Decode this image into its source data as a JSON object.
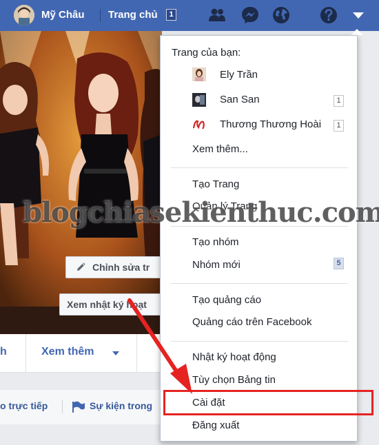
{
  "topbar": {
    "user_name": "Mỹ Châu",
    "home_label": "Trang chủ",
    "home_badge": "1",
    "icons": [
      "friends-icon",
      "messenger-icon",
      "globe-icon",
      "help-icon",
      "dropdown-caret-icon"
    ],
    "bar_color": "#4267b2"
  },
  "cover": {
    "edit_label": "Chỉnh sửa tr",
    "log_label": "Xem nhật ký hoạt"
  },
  "nav": {
    "partial_tab": "h",
    "more_label": "Xem thêm"
  },
  "subbar": {
    "live_label": "o trực tiếp",
    "event_label": "Sự kiện trong"
  },
  "dropdown": {
    "pages_header": "Trang của bạn:",
    "pages": [
      {
        "name": "Ely Trần",
        "count": ""
      },
      {
        "name": "San San",
        "count": "1"
      },
      {
        "name": "Thương Thương Hoài",
        "count": "1"
      }
    ],
    "see_more": "Xem thêm...",
    "create_page": "Tạo Trang",
    "manage_pages": "Quản lý Trang",
    "create_group": "Tạo nhóm",
    "new_groups": "Nhóm mới",
    "new_groups_count": "5",
    "create_ad": "Tạo quảng cáo",
    "fb_ads": "Quảng cáo trên Facebook",
    "activity_log": "Nhật ký hoạt động",
    "news_feed_prefs": "Tùy chọn Bảng tin",
    "settings": "Cài đặt",
    "logout": "Đăng xuất",
    "highlight_color": "#e52321"
  },
  "watermark": "blogchiasekienthuc.com"
}
